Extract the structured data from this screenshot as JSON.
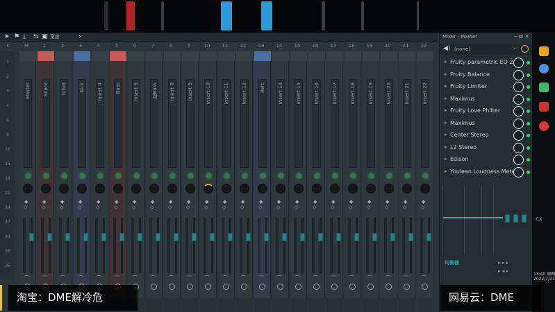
{
  "toolbar": {
    "label": "宽度"
  },
  "track_numbers": [
    "C",
    "M",
    "1",
    "2",
    "3",
    "4",
    "5",
    "6",
    "7",
    "8",
    "9",
    "10",
    "11",
    "12",
    "13",
    "14",
    "15",
    "16",
    "17",
    "18",
    "19",
    "20",
    "21",
    "22"
  ],
  "scale_marks": [
    "1",
    "2",
    "3",
    "4",
    "6",
    "9",
    "12",
    "15",
    "18",
    "21",
    "24",
    "27",
    "30",
    "33",
    "36"
  ],
  "tracks": [
    {
      "name": "Master",
      "color": "normal",
      "knob": "normal",
      "route": "normal"
    },
    {
      "name": "Snare",
      "color": "red",
      "knob": "normal",
      "route": "normal"
    },
    {
      "name": "Inhat",
      "color": "normal",
      "knob": "normal",
      "route": "normal"
    },
    {
      "name": "Kick",
      "color": "blue",
      "knob": "normal",
      "route": "orange"
    },
    {
      "name": "Insert 4",
      "color": "normal",
      "knob": "normal",
      "route": "normal"
    },
    {
      "name": "Bass",
      "color": "red",
      "knob": "normal",
      "route": "orange"
    },
    {
      "name": "Insert 6",
      "color": "normal",
      "knob": "normal",
      "route": "normal"
    },
    {
      "name": "胶Bass",
      "color": "normal",
      "knob": "normal",
      "route": "normal"
    },
    {
      "name": "Insert 8",
      "color": "normal",
      "knob": "normal",
      "route": "normal"
    },
    {
      "name": "Insert 9",
      "color": "normal",
      "knob": "normal",
      "route": "normal"
    },
    {
      "name": "Insert 10",
      "color": "normal",
      "knob": "orange",
      "route": "normal"
    },
    {
      "name": "Insert 11",
      "color": "normal",
      "knob": "normal",
      "route": "normal"
    },
    {
      "name": "Insert 12",
      "color": "normal",
      "knob": "normal",
      "route": "normal"
    },
    {
      "name": "Perc",
      "color": "blue",
      "knob": "normal",
      "route": "normal"
    },
    {
      "name": "Insert 14",
      "color": "normal",
      "knob": "normal",
      "route": "normal"
    },
    {
      "name": "Insert 15",
      "color": "normal",
      "knob": "normal",
      "route": "normal"
    },
    {
      "name": "Insert 16",
      "color": "normal",
      "knob": "normal",
      "route": "normal"
    },
    {
      "name": "Insert 17",
      "color": "normal",
      "knob": "normal",
      "route": "normal"
    },
    {
      "name": "Insert 18",
      "color": "normal",
      "knob": "normal",
      "route": "normal"
    },
    {
      "name": "Insert 19",
      "color": "normal",
      "knob": "normal",
      "route": "normal"
    },
    {
      "name": "Insert 20",
      "color": "normal",
      "knob": "normal",
      "route": "normal"
    },
    {
      "name": "Insert 21",
      "color": "normal",
      "knob": "normal",
      "route": "normal"
    },
    {
      "name": "Insert 22",
      "color": "normal",
      "knob": "normal",
      "route": "normal"
    }
  ],
  "right_panel": {
    "title": "Mixer - Master",
    "preset": "(none)",
    "slots": [
      "Fruity parametric EQ 2",
      "Fruity Balance",
      "Fruity Limiter",
      "Maximus",
      "Fruity Love Philter",
      "Maximus",
      "Center Stereo",
      "L2 Stereo",
      "Edison",
      "Youlean Loudness Mete..."
    ],
    "bottom_label": "均衡器"
  },
  "desktop": {
    "label_cx": "CX",
    "time": "13:40 周四",
    "date": "2022/7/21"
  },
  "watermark": {
    "left": "淘宝：DME解冷危",
    "right": "网易云：DME"
  },
  "colors": {
    "accent": "#2a7f8a",
    "led": "#3fcf6f",
    "red_track": "#c65a5a",
    "blue_track": "#4f6fa4"
  }
}
